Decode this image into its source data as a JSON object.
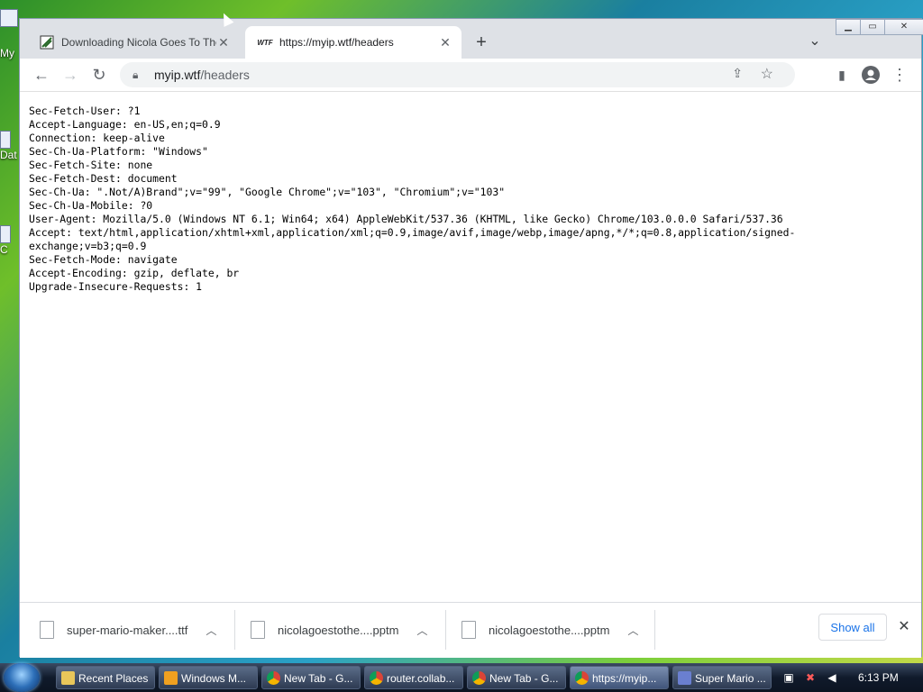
{
  "desktop": {
    "icons": [
      {
        "label": "My",
        "icon": "computer-icon"
      },
      {
        "label": "Dat",
        "icon": "folder-icon"
      },
      {
        "label": "C",
        "icon": "shortcut-icon"
      }
    ]
  },
  "tabs": [
    {
      "title": "Downloading Nicola Goes To The",
      "icon": "download-favicon",
      "active": false
    },
    {
      "title": "https://myip.wtf/headers",
      "favicon_text": "WTF",
      "icon": "wtf-favicon",
      "active": true
    }
  ],
  "toolbar": {
    "url_host": "myip.wtf",
    "url_path": "/headers",
    "icons": [
      "back-icon",
      "forward-icon",
      "reload-icon",
      "lock-icon",
      "share-icon",
      "star-icon",
      "side-panel-icon",
      "profile-icon",
      "menu-icon"
    ]
  },
  "content": {
    "lines": [
      "Sec-Fetch-User: ?1",
      "Accept-Language: en-US,en;q=0.9",
      "Connection: keep-alive",
      "Sec-Ch-Ua-Platform: \"Windows\"",
      "Sec-Fetch-Site: none",
      "Sec-Fetch-Dest: document",
      "Sec-Ch-Ua: \".Not/A)Brand\";v=\"99\", \"Google Chrome\";v=\"103\", \"Chromium\";v=\"103\"",
      "Sec-Ch-Ua-Mobile: ?0",
      "User-Agent: Mozilla/5.0 (Windows NT 6.1; Win64; x64) AppleWebKit/537.36 (KHTML, like Gecko) Chrome/103.0.0.0 Safari/537.36",
      "Accept: text/html,application/xhtml+xml,application/xml;q=0.9,image/avif,image/webp,image/apng,*/*;q=0.8,application/signed-",
      "exchange;v=b3;q=0.9",
      "Sec-Fetch-Mode: navigate",
      "Accept-Encoding: gzip, deflate, br",
      "Upgrade-Insecure-Requests: 1"
    ]
  },
  "downloads": {
    "items": [
      {
        "name": "super-mario-maker....ttf"
      },
      {
        "name": "nicolagoestothe....pptm"
      },
      {
        "name": "nicolagoestothe....pptm"
      }
    ],
    "show_all": "Show all"
  },
  "taskbar": {
    "items": [
      {
        "label": "Recent Places",
        "icon": "folder-icon"
      },
      {
        "label": "Windows M...",
        "icon": "media-icon"
      },
      {
        "label": "New Tab - G...",
        "icon": "chrome-icon"
      },
      {
        "label": "router.collab...",
        "icon": "chrome-icon"
      },
      {
        "label": "New Tab - G...",
        "icon": "chrome-icon"
      },
      {
        "label": "https://myip...",
        "icon": "chrome-icon",
        "active": true
      },
      {
        "label": "Super Mario ...",
        "icon": "app-icon"
      }
    ],
    "clock": "6:13 PM"
  }
}
